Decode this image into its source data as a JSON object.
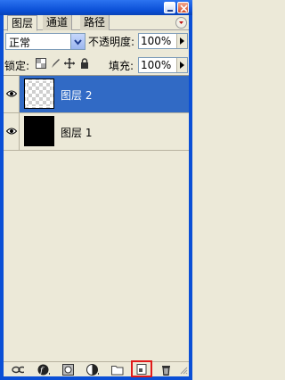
{
  "tabs": [
    {
      "label": "图层",
      "active": true
    },
    {
      "label": "通道",
      "active": false
    },
    {
      "label": "路径",
      "active": false
    }
  ],
  "blend_mode": {
    "value": "正常"
  },
  "opacity": {
    "label": "不透明度:",
    "value": "100%"
  },
  "lock": {
    "label": "锁定:"
  },
  "fill": {
    "label": "填充:",
    "value": "100%"
  },
  "layers": [
    {
      "name": "图层 2",
      "visible": true,
      "selected": true,
      "thumbnail": "transparent"
    },
    {
      "name": "图层 1",
      "visible": true,
      "selected": false,
      "thumbnail": "black"
    }
  ],
  "colors": {
    "titlebar": "#0a4fd6",
    "selection": "#316ac5",
    "highlight": "#e01a1a",
    "panel": "#ece9d8"
  },
  "bottom_tools": [
    "link-icon",
    "layer-style-icon",
    "layer-mask-icon",
    "adjustment-layer-icon",
    "new-group-icon",
    "new-layer-icon",
    "trash-icon"
  ]
}
